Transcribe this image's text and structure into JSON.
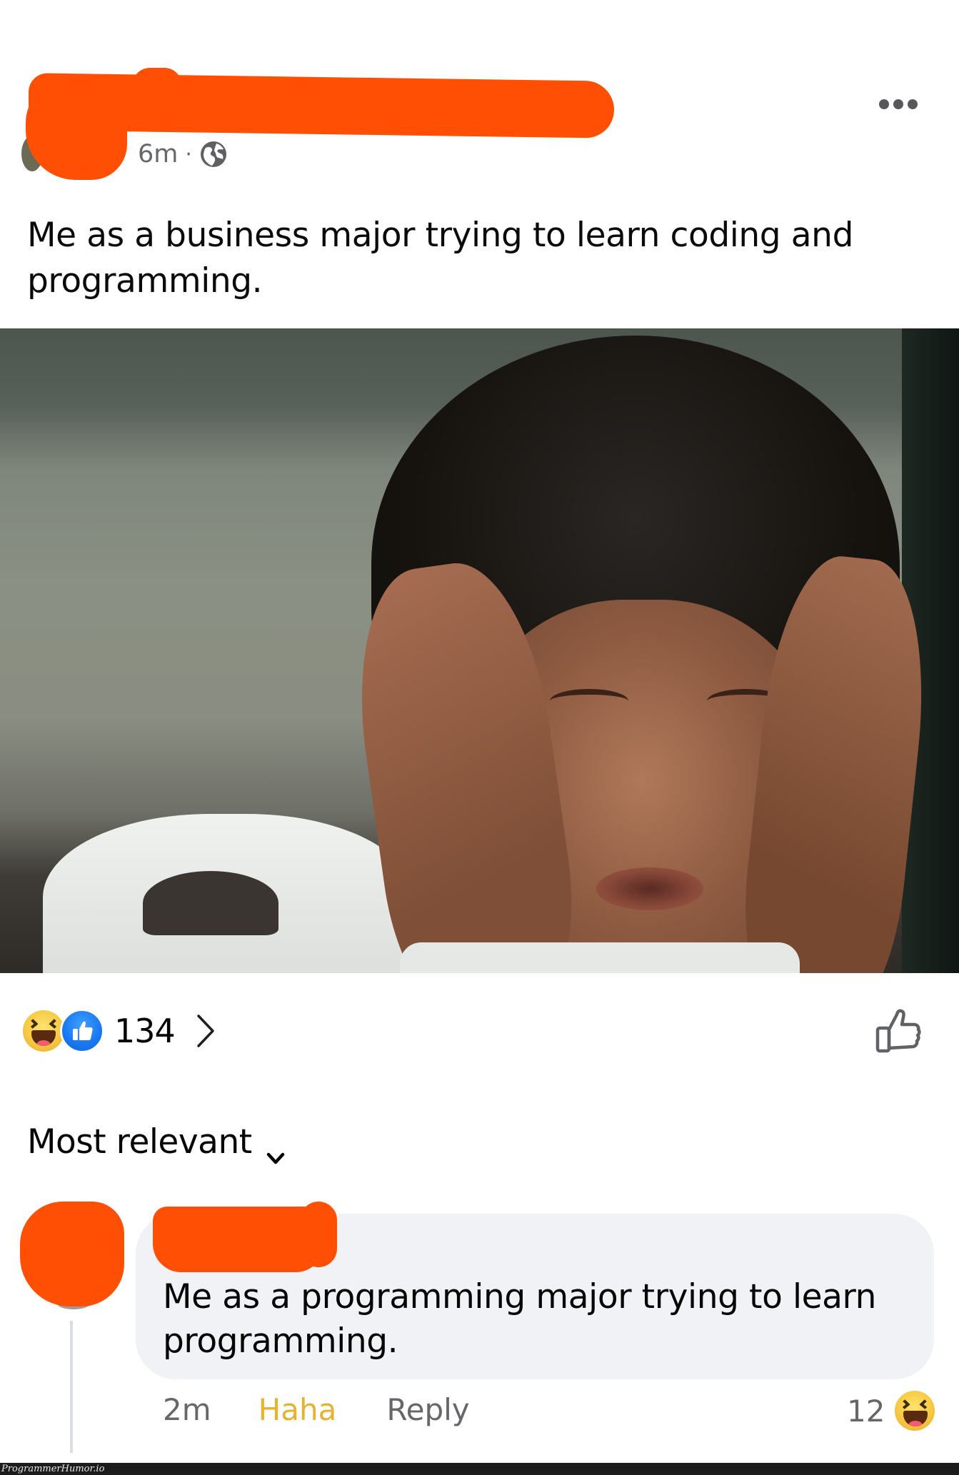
{
  "post": {
    "author_name": "[redacted]",
    "timestamp": "6m",
    "separator": "·",
    "audience_icon": "globe-icon",
    "more_icon": "more-horizontal-icon",
    "caption": "Me as a business major trying to learn coding and programming.",
    "photo_description": "Man with black hair holding his head in both hands with a pained expression, white pillow in the foreground"
  },
  "reactions": {
    "icons": [
      "haha-reaction-icon",
      "like-reaction-icon"
    ],
    "count": "134",
    "chevron_icon": "chevron-right-icon",
    "like_button_icon": "thumbs-up-outline-icon"
  },
  "comments": {
    "sort_label": "Most relevant",
    "sort_icon": "chevron-down-icon",
    "items": [
      {
        "author_name": "[redacted]",
        "text": "Me as a programming major trying to learn programming.",
        "time": "2m",
        "haha_label": "Haha",
        "reply_label": "Reply",
        "reaction_count": "12",
        "reaction_icon": "haha-reaction-icon"
      }
    ]
  },
  "colors": {
    "redaction": "#ff4f05",
    "like_blue": "#1877f2",
    "haha_yellow": "#e8b12f",
    "secondary_text": "#65676b",
    "bubble_bg": "#f0f2f5"
  },
  "watermark": {
    "text": "ProgrammerHumor.io"
  }
}
